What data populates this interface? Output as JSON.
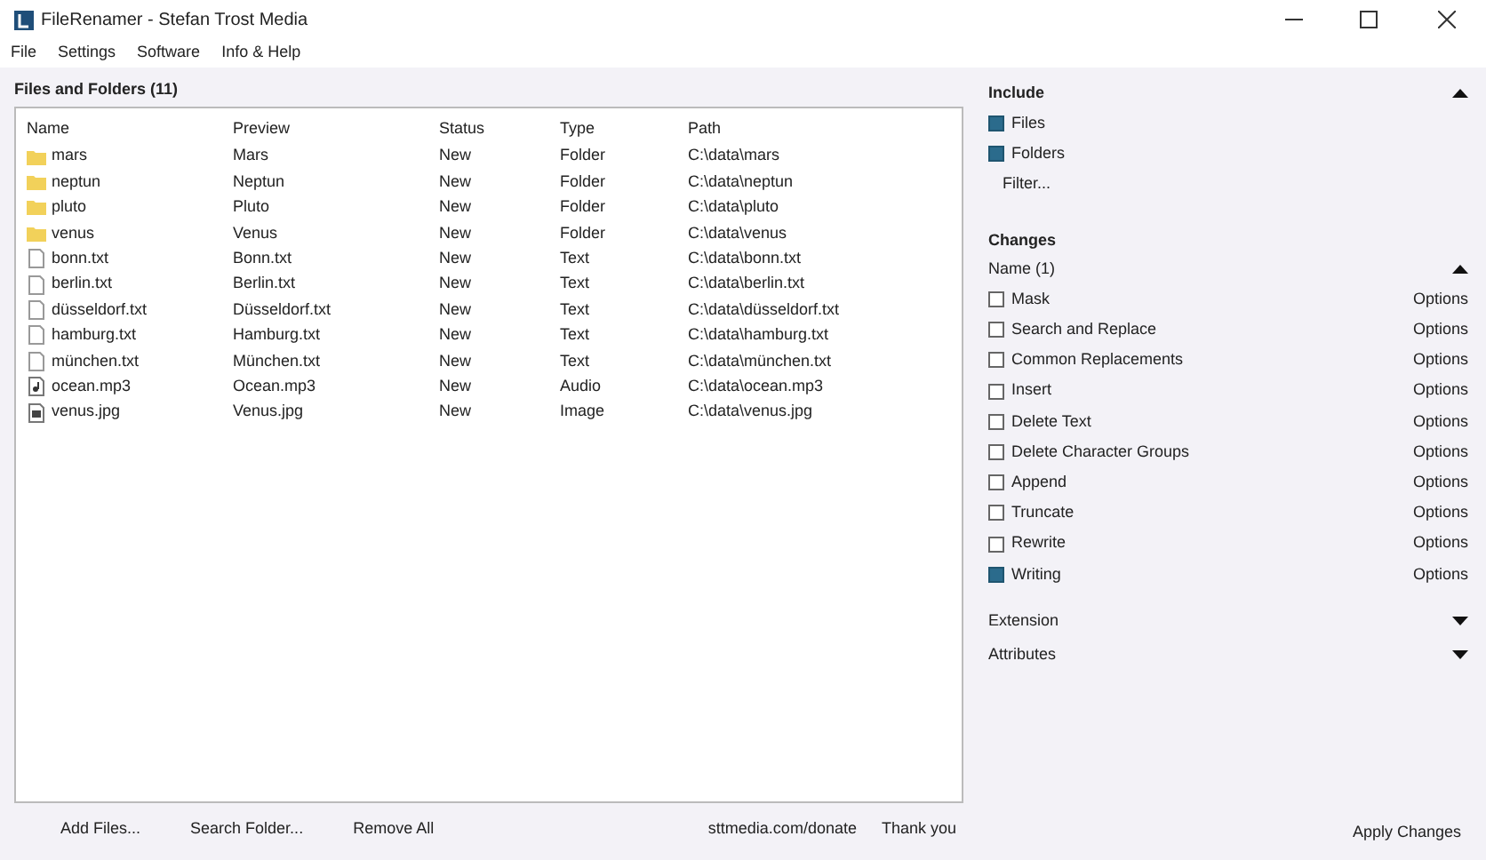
{
  "window": {
    "title": "FileRenamer - Stefan Trost Media"
  },
  "menu": [
    "File",
    "Settings",
    "Software",
    "Info & Help"
  ],
  "files_panel": {
    "title": "Files and Folders (11)",
    "columns": [
      "Name",
      "Preview",
      "Status",
      "Type",
      "Path"
    ],
    "rows": [
      {
        "kind": "folder",
        "cells": [
          "mars",
          "Mars",
          "New",
          "Folder",
          "C:\\data\\mars"
        ]
      },
      {
        "kind": "folder",
        "cells": [
          "neptun",
          "Neptun",
          "New",
          "Folder",
          "C:\\data\\neptun"
        ]
      },
      {
        "kind": "folder",
        "cells": [
          "pluto",
          "Pluto",
          "New",
          "Folder",
          "C:\\data\\pluto"
        ]
      },
      {
        "kind": "folder",
        "cells": [
          "venus",
          "Venus",
          "New",
          "Folder",
          "C:\\data\\venus"
        ]
      },
      {
        "kind": "file",
        "cells": [
          "bonn.txt",
          "Bonn.txt",
          "New",
          "Text",
          "C:\\data\\bonn.txt"
        ]
      },
      {
        "kind": "file",
        "cells": [
          "berlin.txt",
          "Berlin.txt",
          "New",
          "Text",
          "C:\\data\\berlin.txt"
        ]
      },
      {
        "kind": "file",
        "cells": [
          "düsseldorf.txt",
          "Düsseldorf.txt",
          "New",
          "Text",
          "C:\\data\\düsseldorf.txt"
        ]
      },
      {
        "kind": "file",
        "cells": [
          "hamburg.txt",
          "Hamburg.txt",
          "New",
          "Text",
          "C:\\data\\hamburg.txt"
        ]
      },
      {
        "kind": "file",
        "cells": [
          "münchen.txt",
          "München.txt",
          "New",
          "Text",
          "C:\\data\\münchen.txt"
        ]
      },
      {
        "kind": "audio",
        "cells": [
          "ocean.mp3",
          "Ocean.mp3",
          "New",
          "Audio",
          "C:\\data\\ocean.mp3"
        ]
      },
      {
        "kind": "image",
        "cells": [
          "venus.jpg",
          "Venus.jpg",
          "New",
          "Image",
          "C:\\data\\venus.jpg"
        ]
      }
    ]
  },
  "include": {
    "title": "Include",
    "expanded": true,
    "options": [
      {
        "label": "Files",
        "checked": true
      },
      {
        "label": "Folders",
        "checked": true
      }
    ],
    "filter_button": "Filter..."
  },
  "changes": {
    "title": "Changes",
    "name_section": {
      "title": "Name (1)",
      "expanded": true,
      "items": [
        {
          "label": "Mask",
          "checked": false,
          "options": "Options"
        },
        {
          "label": "Search and Replace",
          "checked": false,
          "options": "Options"
        },
        {
          "label": "Common Replacements",
          "checked": false,
          "options": "Options"
        },
        {
          "label": "Insert",
          "checked": false,
          "options": "Options"
        },
        {
          "label": "Delete Text",
          "checked": false,
          "options": "Options"
        },
        {
          "label": "Delete Character Groups",
          "checked": false,
          "options": "Options"
        },
        {
          "label": "Append",
          "checked": false,
          "options": "Options"
        },
        {
          "label": "Truncate",
          "checked": false,
          "options": "Options"
        },
        {
          "label": "Rewrite",
          "checked": false,
          "options": "Options"
        },
        {
          "label": "Writing",
          "checked": true,
          "options": "Options"
        }
      ]
    },
    "sections": [
      {
        "title": "Extension",
        "expanded": false
      },
      {
        "title": "Attributes",
        "expanded": false
      }
    ]
  },
  "bottom_bar": {
    "buttons": [
      "Add Files...",
      "Search Folder...",
      "Remove All"
    ],
    "donate_link": "sttmedia.com/donate",
    "thanks": "Thank you",
    "apply_button": "Apply Changes"
  }
}
